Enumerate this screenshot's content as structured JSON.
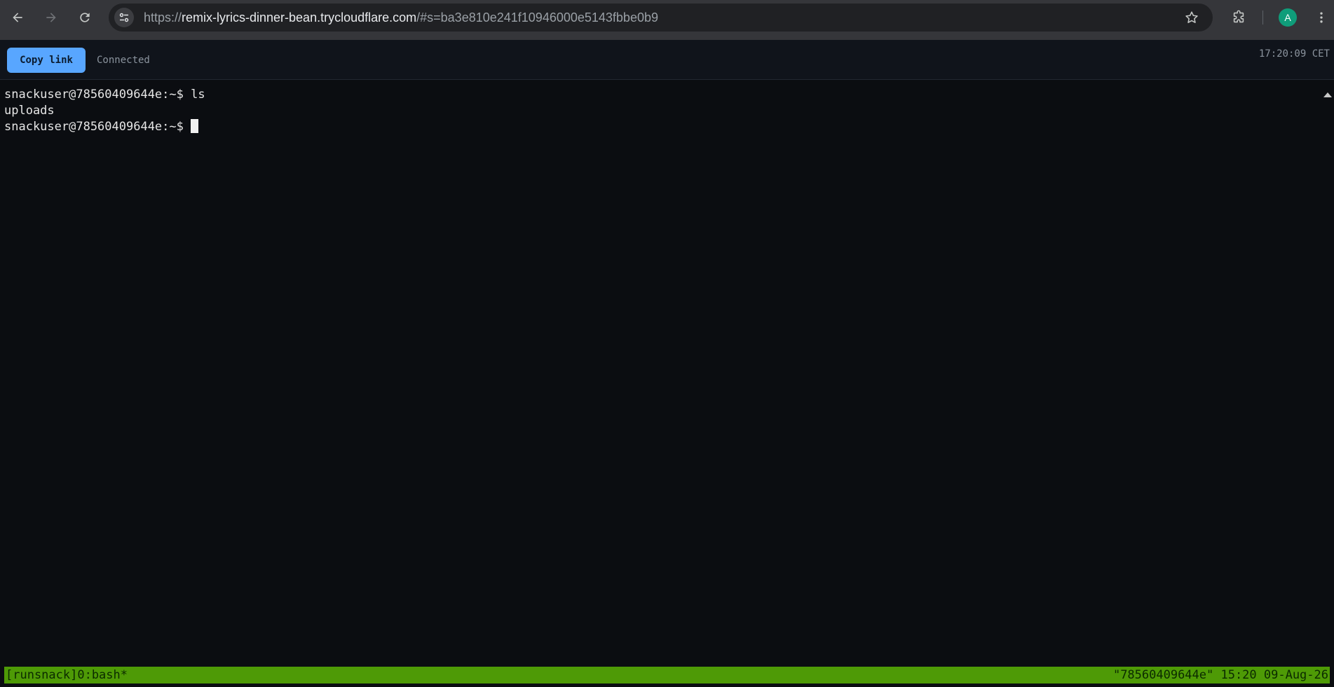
{
  "browser": {
    "url_scheme": "https://",
    "url_host": "remix-lyrics-dinner-bean.trycloudflare.com",
    "url_rest": "/#s=ba3e810e241f10946000e5143fbbe0b9",
    "avatar_initial": "A",
    "icons": [
      "back-icon",
      "forward-icon",
      "reload-icon",
      "site-info-icon",
      "bookmark-star-icon",
      "extensions-icon",
      "menu-icon"
    ]
  },
  "header": {
    "copy_link_label": "Copy link",
    "status_text": "Connected",
    "clock": "17:20:09 CET",
    "accent_color": "#58a6ff"
  },
  "terminal": {
    "lines": [
      "snackuser@78560409644e:~$ ls",
      "uploads",
      "snackuser@78560409644e:~$"
    ]
  },
  "tmux": {
    "left": "[runsnack]0:bash*",
    "right": "\"78560409644e\" 15:20 09-Aug-26",
    "bar_color": "#4e9a06"
  }
}
